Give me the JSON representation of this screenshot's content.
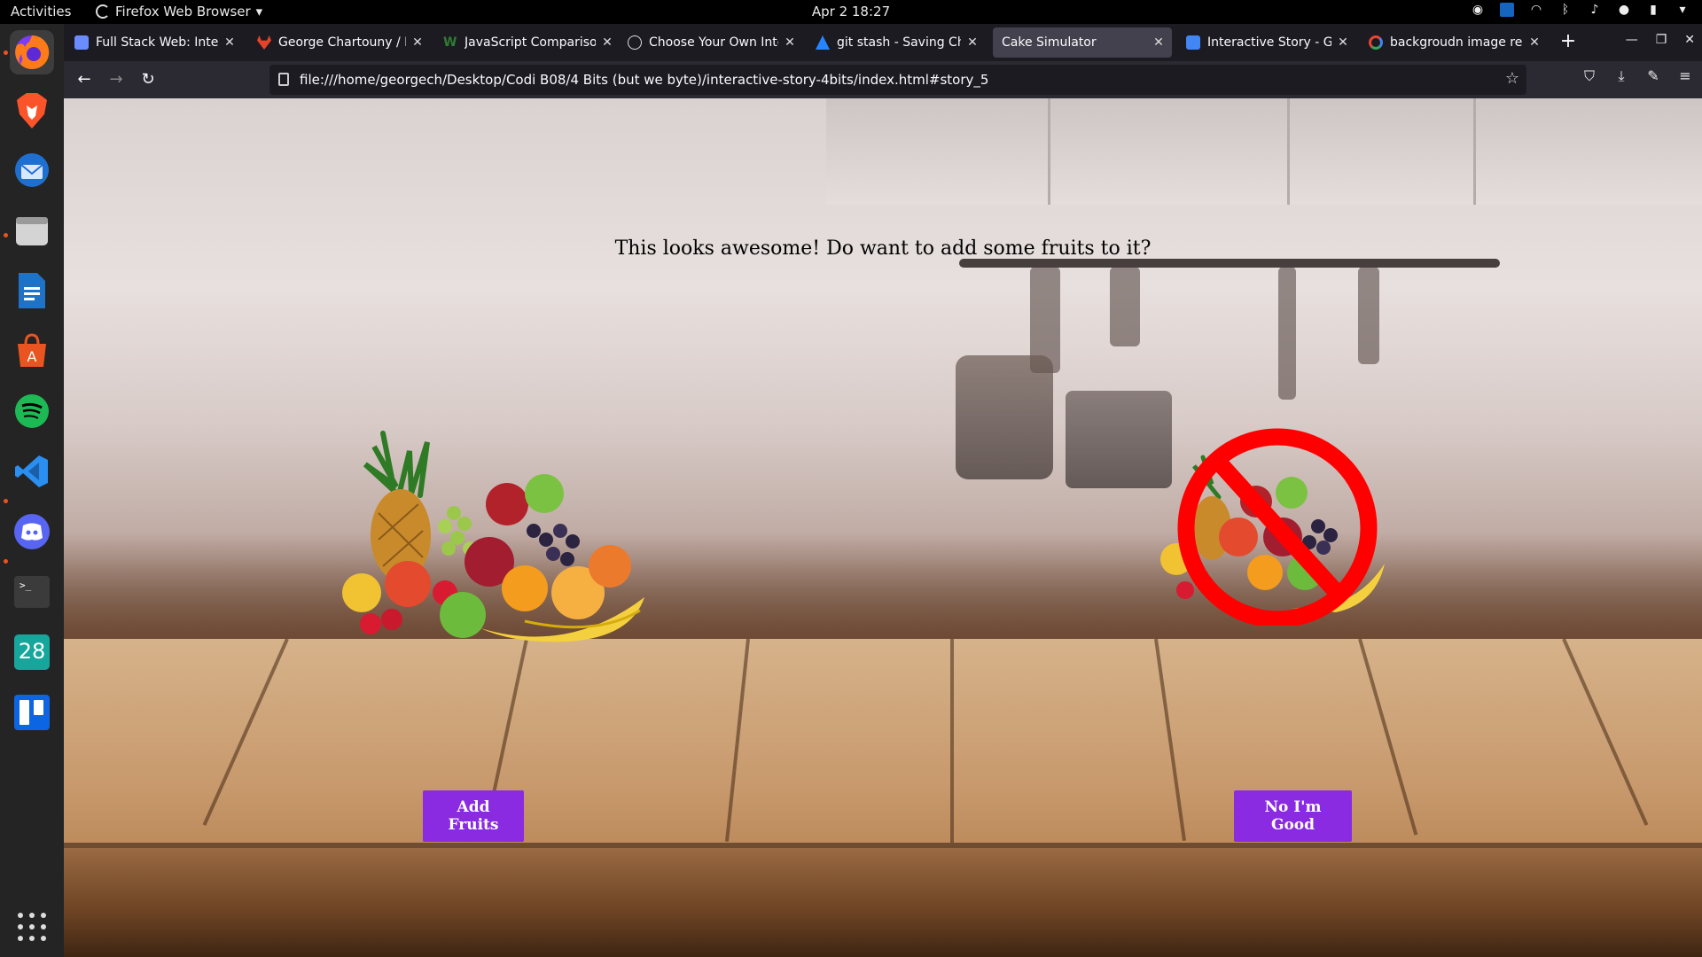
{
  "topbar": {
    "activities": "Activities",
    "app_name": "Firefox Web Browser",
    "clock": "Apr 2  18:27"
  },
  "dock": {
    "apps": [
      "firefox",
      "brave",
      "thunderbird",
      "files",
      "libreoffice-writer",
      "app-center",
      "spotify",
      "vscode",
      "discord",
      "terminal",
      "calendar",
      "trello"
    ],
    "calendar_day": "28"
  },
  "browser": {
    "tabs": [
      {
        "label": "Full Stack Web: Interac",
        "favicon_color": "#6b8cff"
      },
      {
        "label": "George Chartouny / Int",
        "favicon_color": "#e24329"
      },
      {
        "label": "JavaScript Comparison",
        "favicon_color": "#2e7d32"
      },
      {
        "label": "Choose Your Own Inte",
        "favicon_color": "#ffffff"
      },
      {
        "label": "git stash - Saving Chang",
        "favicon_color": "#2684ff"
      },
      {
        "label": "Cake Simulator",
        "favicon_color": ""
      },
      {
        "label": "Interactive Story - Goo",
        "favicon_color": "#4285f4"
      },
      {
        "label": "backgroudn image rem",
        "favicon_color": "#ea4335"
      }
    ],
    "url": "file:///home/georgech/Desktop/Codi B08/4 Bits (but we byte)/interactive-story-4bits/index.html#story_5"
  },
  "page": {
    "question": "This looks awesome! Do want to add some fruits to it?",
    "add_button": "Add Fruits",
    "decline_button": "No I'm Good"
  },
  "colors": {
    "button_bg": "#8a2be2",
    "no_sign": "#ff0000"
  }
}
